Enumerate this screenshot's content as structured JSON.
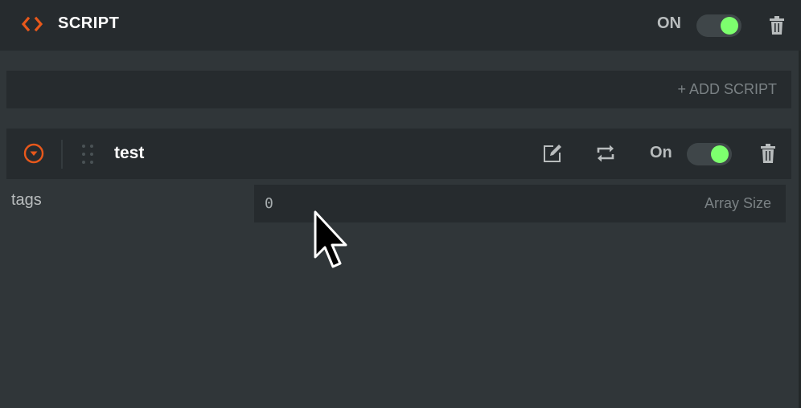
{
  "header": {
    "title": "SCRIPT",
    "enabled_label": "ON",
    "enabled": true
  },
  "add_script": {
    "label": "+ ADD SCRIPT"
  },
  "scripts": [
    {
      "name": "test",
      "enabled_label": "On",
      "enabled": true,
      "attributes": [
        {
          "label": "tags",
          "value": "0",
          "hint": "Array Size"
        }
      ]
    }
  ],
  "colors": {
    "accent": "#e8581b",
    "toggle_on": "#7dff6e",
    "panel": "#262b2e",
    "background": "#303639"
  }
}
